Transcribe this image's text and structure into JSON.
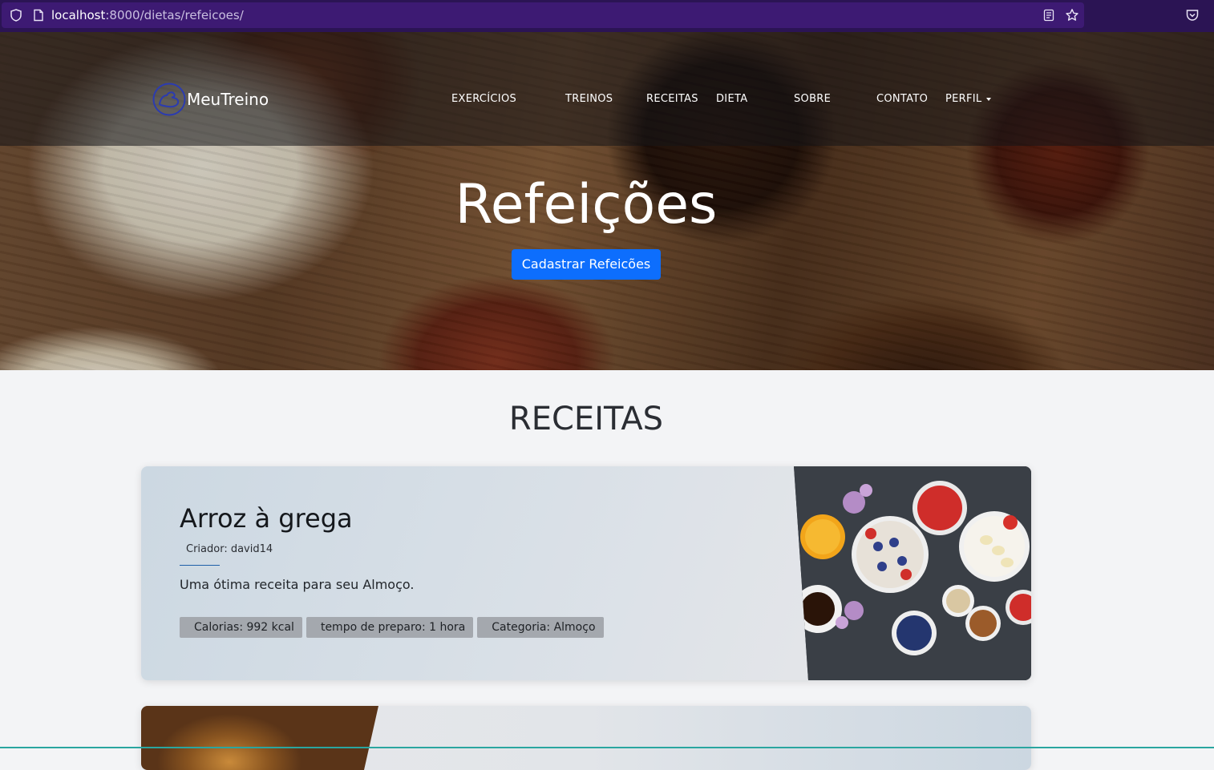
{
  "browser": {
    "url_host": "localhost",
    "url_rest": ":8000/dietas/refeicoes/"
  },
  "navbar": {
    "brand": "MeuTreino",
    "items": [
      {
        "label": "EXERCÍCIOS"
      },
      {
        "label": "TREINOS"
      },
      {
        "label": "RECEITAS"
      },
      {
        "label": "DIETA"
      },
      {
        "label": "SOBRE"
      },
      {
        "label": "CONTATO"
      },
      {
        "label": "PERFIL"
      }
    ]
  },
  "hero": {
    "title": "Refeições",
    "button_label": "Cadastrar Refeicões"
  },
  "section": {
    "title": "RECEITAS"
  },
  "recipes": [
    {
      "title": "Arroz à grega",
      "creator": "Criador: david14",
      "description": "Uma ótima receita para seu Almoço.",
      "badges": [
        "Calorias: 992 kcal",
        "tempo de preparo: 1 hora",
        "Categoria: Almoço"
      ]
    }
  ],
  "colors": {
    "primary_button": "#0d6efd",
    "page_background": "#f3f4f6",
    "browser_frame": "#2b1454"
  }
}
